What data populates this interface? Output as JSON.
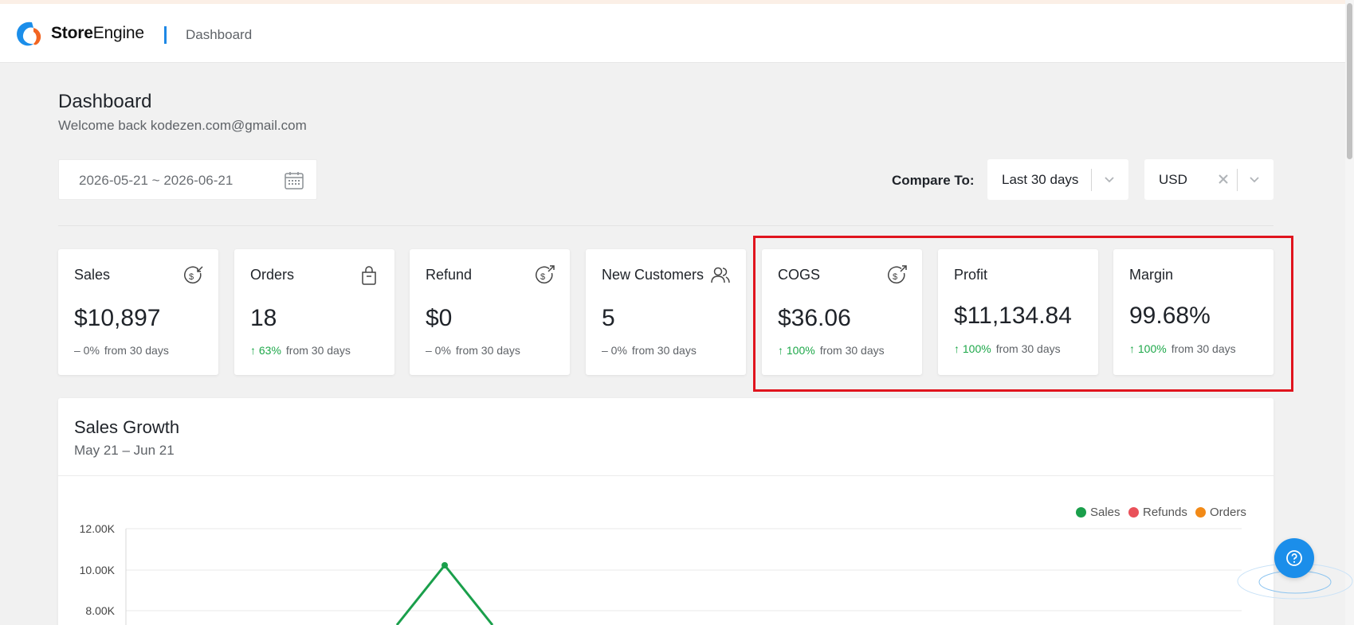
{
  "header": {
    "brand_bold": "Store",
    "brand_regular": "Engine",
    "crumb": "Dashboard"
  },
  "page": {
    "title": "Dashboard",
    "subtitle": "Welcome back kodezen.com@gmail.com"
  },
  "filters": {
    "date_range": "2026-05-21 ~ 2026-06-21",
    "compare_label": "Compare To:",
    "compare_value": "Last 30 days",
    "currency_value": "USD"
  },
  "cards": [
    {
      "title": "Sales",
      "value": "$10,897",
      "change": "– 0%",
      "direction": "flat",
      "suffix": "from 30 days",
      "icon": "dollar-in-icon"
    },
    {
      "title": "Orders",
      "value": "18",
      "change": "↑ 63%",
      "direction": "up",
      "suffix": "from 30 days",
      "icon": "shopping-bag-icon"
    },
    {
      "title": "Refund",
      "value": "$0",
      "change": "– 0%",
      "direction": "flat",
      "suffix": "from 30 days",
      "icon": "dollar-out-icon"
    },
    {
      "title": "New Customers",
      "value": "5",
      "change": "– 0%",
      "direction": "flat",
      "suffix": "from 30 days",
      "icon": "users-icon"
    },
    {
      "title": "COGS",
      "value": "$36.06",
      "change": "↑ 100%",
      "direction": "up",
      "suffix": "from 30 days",
      "icon": "dollar-out-icon"
    },
    {
      "title": "Profit",
      "value": "$11,134.84",
      "change": "↑ 100%",
      "direction": "up",
      "suffix": "from 30 days",
      "icon": ""
    },
    {
      "title": "Margin",
      "value": "99.68%",
      "change": "↑ 100%",
      "direction": "up",
      "suffix": "from 30 days",
      "icon": ""
    }
  ],
  "sales_growth": {
    "title": "Sales Growth",
    "subtitle": "May 21 – Jun 21",
    "legend": [
      {
        "label": "Sales",
        "color": "#1a9f4b"
      },
      {
        "label": "Refunds",
        "color": "#e9515a"
      },
      {
        "label": "Orders",
        "color": "#f28a17"
      }
    ],
    "y_ticks": [
      "12.00K",
      "10.00K",
      "8.00K"
    ]
  },
  "colors": {
    "accent": "#1b8eea",
    "up": "#1ea84a",
    "highlight": "#e0141e"
  }
}
